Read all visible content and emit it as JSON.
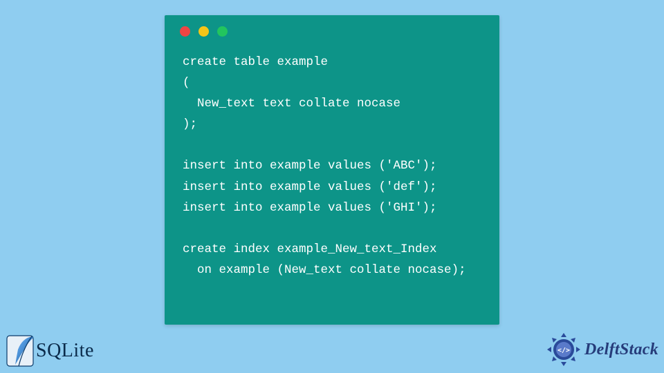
{
  "code": {
    "lines": [
      "create table example",
      "(",
      "  New_text text collate nocase",
      ");",
      "",
      "insert into example values ('ABC');",
      "insert into example values ('def');",
      "insert into example values ('GHI');",
      "",
      "create index example_New_text_Index",
      "  on example (New_text collate nocase);"
    ]
  },
  "logos": {
    "sqlite": "SQLite",
    "delftstack": "DelftStack"
  },
  "dot_colors": {
    "red": "#ef4444",
    "yellow": "#f5c518",
    "green": "#22c55e"
  }
}
